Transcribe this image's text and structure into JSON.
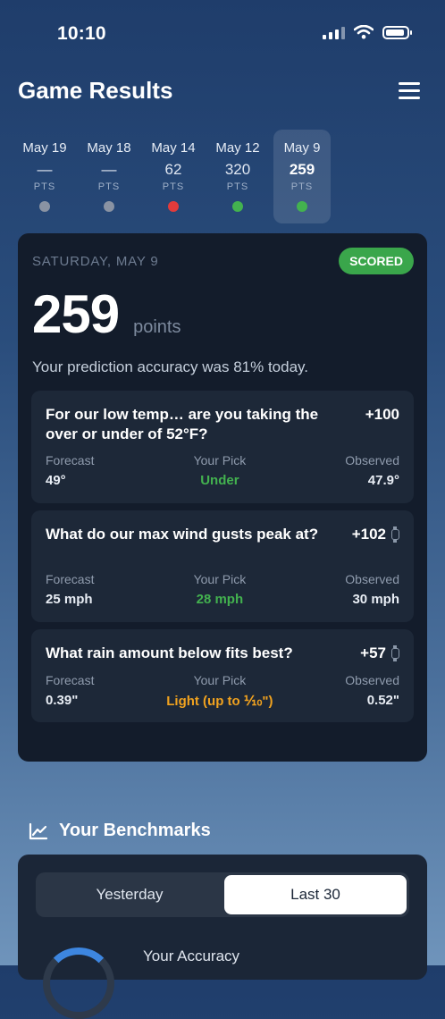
{
  "status": {
    "time": "10:10"
  },
  "header": {
    "title": "Game Results"
  },
  "dates": [
    {
      "date": "May 19",
      "value": "—",
      "pts": "PTS",
      "dot": "#8a93a3",
      "active": false
    },
    {
      "date": "May 18",
      "value": "—",
      "pts": "PTS",
      "dot": "#8a93a3",
      "active": false
    },
    {
      "date": "May 14",
      "value": "62",
      "pts": "PTS",
      "dot": "#e23b3b",
      "active": false
    },
    {
      "date": "May 12",
      "value": "320",
      "pts": "PTS",
      "dot": "#43b24f",
      "active": false
    },
    {
      "date": "May 9",
      "value": "259",
      "pts": "PTS",
      "dot": "#43b24f",
      "active": true
    }
  ],
  "result": {
    "day": "SATURDAY, MAY 9",
    "badge": "SCORED",
    "score": "259",
    "unit": "points",
    "accuracy_text": "Your prediction accuracy was 81% today."
  },
  "questions": [
    {
      "text": "For our low temp… are you taking the over or under of 52°F?",
      "points": "+100",
      "forecast_label": "Forecast",
      "forecast": "49°",
      "pick_label": "Your Pick",
      "pick": "Under",
      "observed_label": "Observed",
      "observed": "47.9°"
    },
    {
      "text": "What do our max wind gusts peak at?",
      "points": "+102",
      "forecast_label": "Forecast",
      "forecast": "25 mph",
      "pick_label": "Your Pick",
      "pick": "28 mph",
      "observed_label": "Observed",
      "observed": "30 mph"
    },
    {
      "text": "What rain amount below fits best?",
      "points": "+57",
      "forecast_label": "Forecast",
      "forecast": "0.39\"",
      "pick_label": "Your Pick",
      "pick": "Light (up to ⅒\")",
      "observed_label": "Observed",
      "observed": "0.52\""
    }
  ],
  "benchmarks": {
    "title": "Your Benchmarks",
    "tabs": [
      "Yesterday",
      "Last 30"
    ],
    "selected": "Last 30",
    "accuracy_label": "Your Accuracy"
  },
  "colors": {
    "accent_green": "#43b24f",
    "accent_orange": "#f0a21f",
    "accent_blue": "#3d86e0"
  }
}
